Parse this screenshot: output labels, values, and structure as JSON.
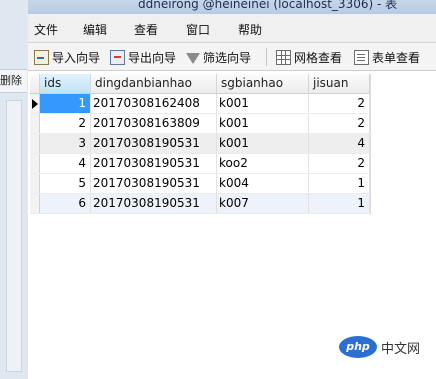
{
  "background_window": {
    "button_label": "删除"
  },
  "window": {
    "title": "ddneirong @heineinei (localhost_3306) - 表"
  },
  "menu": {
    "items": [
      "文件",
      "编辑",
      "查看",
      "窗口",
      "帮助"
    ]
  },
  "toolbar": {
    "import_label": "导入向导",
    "export_label": "导出向导",
    "filter_label": "筛选向导",
    "grid_view_label": "网格查看",
    "form_view_label": "表单查看"
  },
  "table": {
    "columns": [
      "ids",
      "dingdanbianhao",
      "sgbianhao",
      "jisuan"
    ],
    "rows": [
      [
        "1",
        "20170308162408",
        "k001",
        "2"
      ],
      [
        "2",
        "20170308163809",
        "k001",
        "2"
      ],
      [
        "3",
        "20170308190531",
        "k001",
        "4"
      ],
      [
        "4",
        "20170308190531",
        "koo2",
        "2"
      ],
      [
        "5",
        "20170308190531",
        "k004",
        "1"
      ],
      [
        "6",
        "20170308190531",
        "k007",
        "1"
      ]
    ]
  },
  "watermark": {
    "logo_text": "php",
    "text": "中文网"
  },
  "colors": {
    "selection": "#3399ff",
    "titlebar": "#c7d7ea",
    "watermark": "#2a6fd1"
  }
}
